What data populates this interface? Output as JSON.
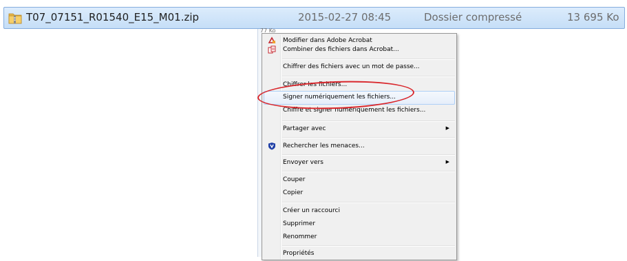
{
  "file": {
    "name": "T07_07151_R01540_E15_M01.zip",
    "date": "2015-02-27 08:45",
    "type": "Dossier compressé",
    "size": "13 695 Ko",
    "icon": "zip-folder-icon"
  },
  "background": {
    "partial_size": "77 Ko"
  },
  "menu": {
    "items": [
      {
        "label": "Modifier dans Adobe Acrobat",
        "icon": "acrobat-edit-icon"
      },
      {
        "label": "Combiner des fichiers dans Acrobat...",
        "icon": "acrobat-combine-icon"
      },
      {
        "label": "Chiffrer des fichiers avec un mot de passe..."
      },
      {
        "label": "Chiffrer les fichiers..."
      },
      {
        "label": "Signer numériquement les fichiers...",
        "highlighted": true
      },
      {
        "label": "Chiffre et signer numériquement les fichiers..."
      },
      {
        "label": "Partager avec",
        "submenu": true
      },
      {
        "label": "Rechercher les menaces...",
        "icon": "shield-icon"
      },
      {
        "label": "Envoyer vers",
        "submenu": true
      },
      {
        "label": "Couper"
      },
      {
        "label": "Copier"
      },
      {
        "label": "Créer un raccourci"
      },
      {
        "label": "Supprimer"
      },
      {
        "label": "Renommer"
      },
      {
        "label": "Propriétés"
      }
    ]
  },
  "colors": {
    "selection": "#c5def7",
    "menu_bg": "#f0f0f0",
    "highlight_border": "#aecff7",
    "annotation": "#d9262b"
  }
}
